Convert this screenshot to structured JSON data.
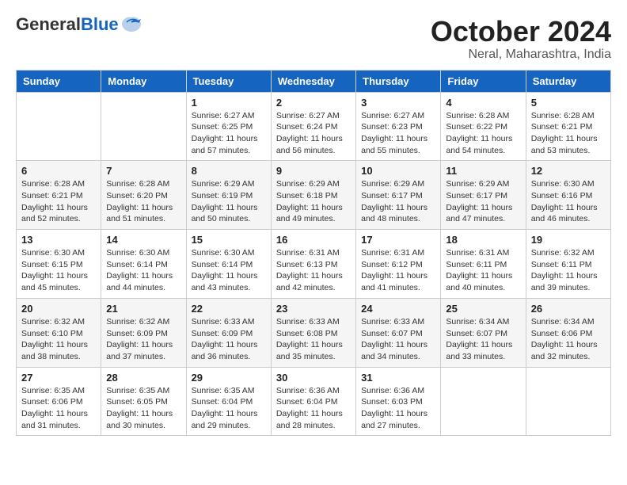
{
  "header": {
    "logo_general": "General",
    "logo_blue": "Blue",
    "month_year": "October 2024",
    "location": "Neral, Maharashtra, India"
  },
  "days_of_week": [
    "Sunday",
    "Monday",
    "Tuesday",
    "Wednesday",
    "Thursday",
    "Friday",
    "Saturday"
  ],
  "weeks": [
    [
      {
        "day": "",
        "info": ""
      },
      {
        "day": "",
        "info": ""
      },
      {
        "day": "1",
        "info": "Sunrise: 6:27 AM\nSunset: 6:25 PM\nDaylight: 11 hours and 57 minutes."
      },
      {
        "day": "2",
        "info": "Sunrise: 6:27 AM\nSunset: 6:24 PM\nDaylight: 11 hours and 56 minutes."
      },
      {
        "day": "3",
        "info": "Sunrise: 6:27 AM\nSunset: 6:23 PM\nDaylight: 11 hours and 55 minutes."
      },
      {
        "day": "4",
        "info": "Sunrise: 6:28 AM\nSunset: 6:22 PM\nDaylight: 11 hours and 54 minutes."
      },
      {
        "day": "5",
        "info": "Sunrise: 6:28 AM\nSunset: 6:21 PM\nDaylight: 11 hours and 53 minutes."
      }
    ],
    [
      {
        "day": "6",
        "info": "Sunrise: 6:28 AM\nSunset: 6:21 PM\nDaylight: 11 hours and 52 minutes."
      },
      {
        "day": "7",
        "info": "Sunrise: 6:28 AM\nSunset: 6:20 PM\nDaylight: 11 hours and 51 minutes."
      },
      {
        "day": "8",
        "info": "Sunrise: 6:29 AM\nSunset: 6:19 PM\nDaylight: 11 hours and 50 minutes."
      },
      {
        "day": "9",
        "info": "Sunrise: 6:29 AM\nSunset: 6:18 PM\nDaylight: 11 hours and 49 minutes."
      },
      {
        "day": "10",
        "info": "Sunrise: 6:29 AM\nSunset: 6:17 PM\nDaylight: 11 hours and 48 minutes."
      },
      {
        "day": "11",
        "info": "Sunrise: 6:29 AM\nSunset: 6:17 PM\nDaylight: 11 hours and 47 minutes."
      },
      {
        "day": "12",
        "info": "Sunrise: 6:30 AM\nSunset: 6:16 PM\nDaylight: 11 hours and 46 minutes."
      }
    ],
    [
      {
        "day": "13",
        "info": "Sunrise: 6:30 AM\nSunset: 6:15 PM\nDaylight: 11 hours and 45 minutes."
      },
      {
        "day": "14",
        "info": "Sunrise: 6:30 AM\nSunset: 6:14 PM\nDaylight: 11 hours and 44 minutes."
      },
      {
        "day": "15",
        "info": "Sunrise: 6:30 AM\nSunset: 6:14 PM\nDaylight: 11 hours and 43 minutes."
      },
      {
        "day": "16",
        "info": "Sunrise: 6:31 AM\nSunset: 6:13 PM\nDaylight: 11 hours and 42 minutes."
      },
      {
        "day": "17",
        "info": "Sunrise: 6:31 AM\nSunset: 6:12 PM\nDaylight: 11 hours and 41 minutes."
      },
      {
        "day": "18",
        "info": "Sunrise: 6:31 AM\nSunset: 6:11 PM\nDaylight: 11 hours and 40 minutes."
      },
      {
        "day": "19",
        "info": "Sunrise: 6:32 AM\nSunset: 6:11 PM\nDaylight: 11 hours and 39 minutes."
      }
    ],
    [
      {
        "day": "20",
        "info": "Sunrise: 6:32 AM\nSunset: 6:10 PM\nDaylight: 11 hours and 38 minutes."
      },
      {
        "day": "21",
        "info": "Sunrise: 6:32 AM\nSunset: 6:09 PM\nDaylight: 11 hours and 37 minutes."
      },
      {
        "day": "22",
        "info": "Sunrise: 6:33 AM\nSunset: 6:09 PM\nDaylight: 11 hours and 36 minutes."
      },
      {
        "day": "23",
        "info": "Sunrise: 6:33 AM\nSunset: 6:08 PM\nDaylight: 11 hours and 35 minutes."
      },
      {
        "day": "24",
        "info": "Sunrise: 6:33 AM\nSunset: 6:07 PM\nDaylight: 11 hours and 34 minutes."
      },
      {
        "day": "25",
        "info": "Sunrise: 6:34 AM\nSunset: 6:07 PM\nDaylight: 11 hours and 33 minutes."
      },
      {
        "day": "26",
        "info": "Sunrise: 6:34 AM\nSunset: 6:06 PM\nDaylight: 11 hours and 32 minutes."
      }
    ],
    [
      {
        "day": "27",
        "info": "Sunrise: 6:35 AM\nSunset: 6:06 PM\nDaylight: 11 hours and 31 minutes."
      },
      {
        "day": "28",
        "info": "Sunrise: 6:35 AM\nSunset: 6:05 PM\nDaylight: 11 hours and 30 minutes."
      },
      {
        "day": "29",
        "info": "Sunrise: 6:35 AM\nSunset: 6:04 PM\nDaylight: 11 hours and 29 minutes."
      },
      {
        "day": "30",
        "info": "Sunrise: 6:36 AM\nSunset: 6:04 PM\nDaylight: 11 hours and 28 minutes."
      },
      {
        "day": "31",
        "info": "Sunrise: 6:36 AM\nSunset: 6:03 PM\nDaylight: 11 hours and 27 minutes."
      },
      {
        "day": "",
        "info": ""
      },
      {
        "day": "",
        "info": ""
      }
    ]
  ]
}
